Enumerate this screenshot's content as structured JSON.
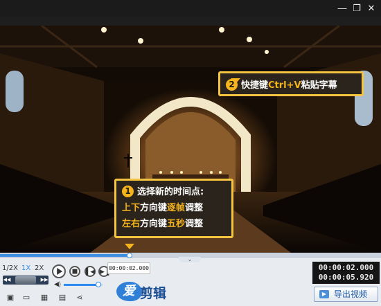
{
  "window": {
    "minimize_glyph": "—",
    "restore_glyph": "❐",
    "close_glyph": "✕"
  },
  "callouts": {
    "top": {
      "number": "2",
      "text_before": "快捷键",
      "text_highlight": "Ctrl+V",
      "text_after": "粘贴字幕"
    },
    "bottom": {
      "number": "1",
      "line1": "选择新的时间点:",
      "line2_highlight": "上下",
      "line2_mid": "方向键",
      "line2_highlight2": "逐帧",
      "line2_end": "调整",
      "line3_highlight": "左右",
      "line3_mid": "方向键",
      "line3_highlight2": "五秒",
      "line3_end": "调整"
    }
  },
  "playback": {
    "progress_fraction": 0.34,
    "speeds": [
      "1/2X",
      "1X",
      "2X"
    ],
    "active_speed": "1X",
    "tooltip_time": "00:00:02.000",
    "current_time": "00:00:02.000",
    "total_time": "00:00:05.920",
    "volume_fraction": 0.9
  },
  "logo": {
    "blob_char": "爱",
    "text": "剪辑"
  },
  "export": {
    "label": "导出视频"
  },
  "icons": {
    "play": "play-icon",
    "stop": "stop-icon",
    "prev_frame": "prev-frame-icon",
    "next_frame": "next-frame-icon",
    "volume": "volume-icon",
    "new": "new-project-icon",
    "open": "open-folder-icon",
    "save": "save-icon",
    "save_as": "save-as-icon",
    "share": "share-icon"
  },
  "colors": {
    "accent_blue": "#2d8cf0",
    "callout_yellow": "#f5b41e",
    "callout_bg": "#2a241c"
  }
}
